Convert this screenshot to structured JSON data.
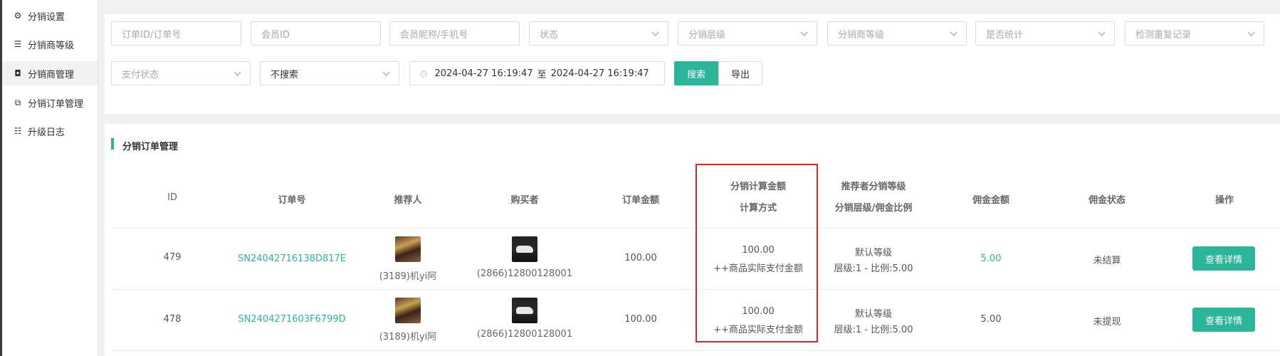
{
  "sidebar": {
    "items": [
      {
        "label": "分销设置",
        "icon": "gear-icon"
      },
      {
        "label": "分销商等级",
        "icon": "sliders-icon"
      },
      {
        "label": "分销商管理",
        "icon": "share-icon"
      },
      {
        "label": "分销订单管理",
        "icon": "copy-icon"
      },
      {
        "label": "升级日志",
        "icon": "list-icon"
      }
    ]
  },
  "filters": {
    "order_id_placeholder": "订单ID/订单号",
    "member_id_placeholder": "会员ID",
    "nickname_placeholder": "会员昵称/手机号",
    "status_placeholder": "状态",
    "level_placeholder": "分销层级",
    "dist_level_placeholder": "分销商等级",
    "stat_placeholder": "是否统计",
    "dup_placeholder": "检测重复记录",
    "pay_status_placeholder": "支付状态",
    "search_mode_value": "不搜索",
    "date_start": "2024-04-27 16:19:47",
    "date_sep": "至",
    "date_end": "2024-04-27 16:19:47",
    "search_label": "搜索",
    "export_label": "导出"
  },
  "table": {
    "section_title": "分销订单管理",
    "headers": {
      "id": "ID",
      "order_no": "订单号",
      "referrer": "推荐人",
      "buyer": "购买者",
      "amount": "订单金额",
      "calc_amount": "分销计算金额",
      "calc_method": "计算方式",
      "ref_level": "推荐者分销等级",
      "level_ratio": "分销层级/佣金比例",
      "commission": "佣金金额",
      "commission_status": "佣金状态",
      "action": "操作"
    },
    "rows": [
      {
        "id": "479",
        "order_no": "SN24042716138D817E",
        "referrer": "(3189)机yi阿",
        "buyer": "(2866)12800128001",
        "amount": "100.00",
        "calc_amount": "100.00",
        "calc_method": "++商品实际支付金额",
        "ref_level": "默认等级",
        "level_ratio": "层级:1 - 比例:5.00",
        "commission": "5.00",
        "commission_status": "未结算",
        "action": "查看详情"
      },
      {
        "id": "478",
        "order_no": "SN2404271603F6799D",
        "referrer": "(3189)机yi阿",
        "buyer": "(2866)12800128001",
        "amount": "100.00",
        "calc_amount": "100.00",
        "calc_method": "++商品实际支付金额",
        "ref_level": "默认等级",
        "level_ratio": "层级:1 - 比例:5.00",
        "commission": "5.00",
        "commission_status": "未提现",
        "action": "查看详情"
      }
    ]
  },
  "colors": {
    "accent": "#2bb599",
    "highlight": "#e3262c"
  }
}
